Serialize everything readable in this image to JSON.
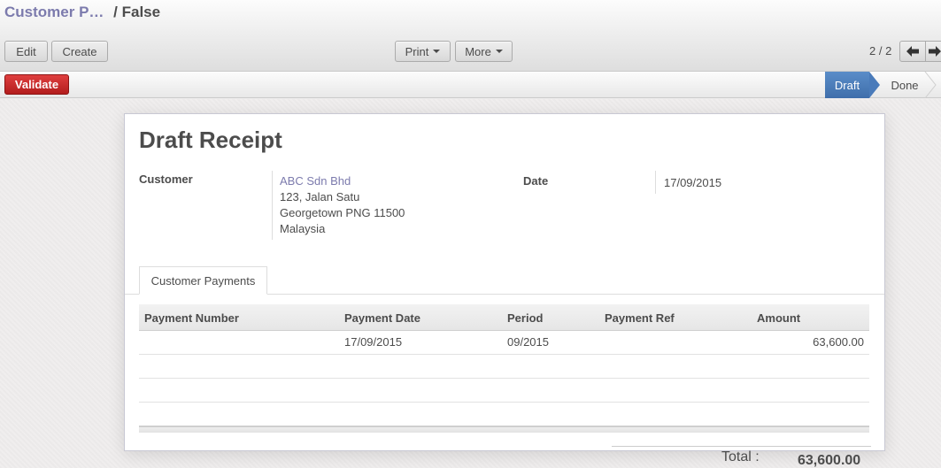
{
  "breadcrumb": {
    "parent": "Customer P…",
    "separator": "/",
    "current": "False"
  },
  "toolbar": {
    "edit_label": "Edit",
    "create_label": "Create",
    "print_label": "Print",
    "more_label": "More"
  },
  "pager": {
    "text": "2 / 2",
    "prev_icon": "arrow-left-icon",
    "next_icon": "arrow-right-icon"
  },
  "statusbar": {
    "validate_label": "Validate",
    "stages": [
      {
        "label": "Draft",
        "active": true
      },
      {
        "label": "Done",
        "active": false
      }
    ]
  },
  "form": {
    "title": "Draft Receipt",
    "customer_label": "Customer",
    "customer": {
      "name": "ABC Sdn Bhd",
      "address": [
        "123, Jalan Satu",
        "Georgetown PNG 11500",
        "Malaysia"
      ]
    },
    "date_label": "Date",
    "date_value": "17/09/2015"
  },
  "tabs": [
    {
      "label": "Customer Payments",
      "active": true
    }
  ],
  "table": {
    "columns": [
      "Payment Number",
      "Payment Date",
      "Period",
      "Payment Ref",
      "Amount"
    ],
    "rows": [
      {
        "payment_number": "",
        "payment_date": "17/09/2015",
        "period": "09/2015",
        "payment_ref": "",
        "amount": "63,600.00"
      }
    ]
  },
  "totals": {
    "label": "Total :",
    "value": "63,600.00"
  },
  "colors": {
    "link": "#7c7bad",
    "validate": "#c12a2a",
    "stage_active": "#4a7bba"
  }
}
